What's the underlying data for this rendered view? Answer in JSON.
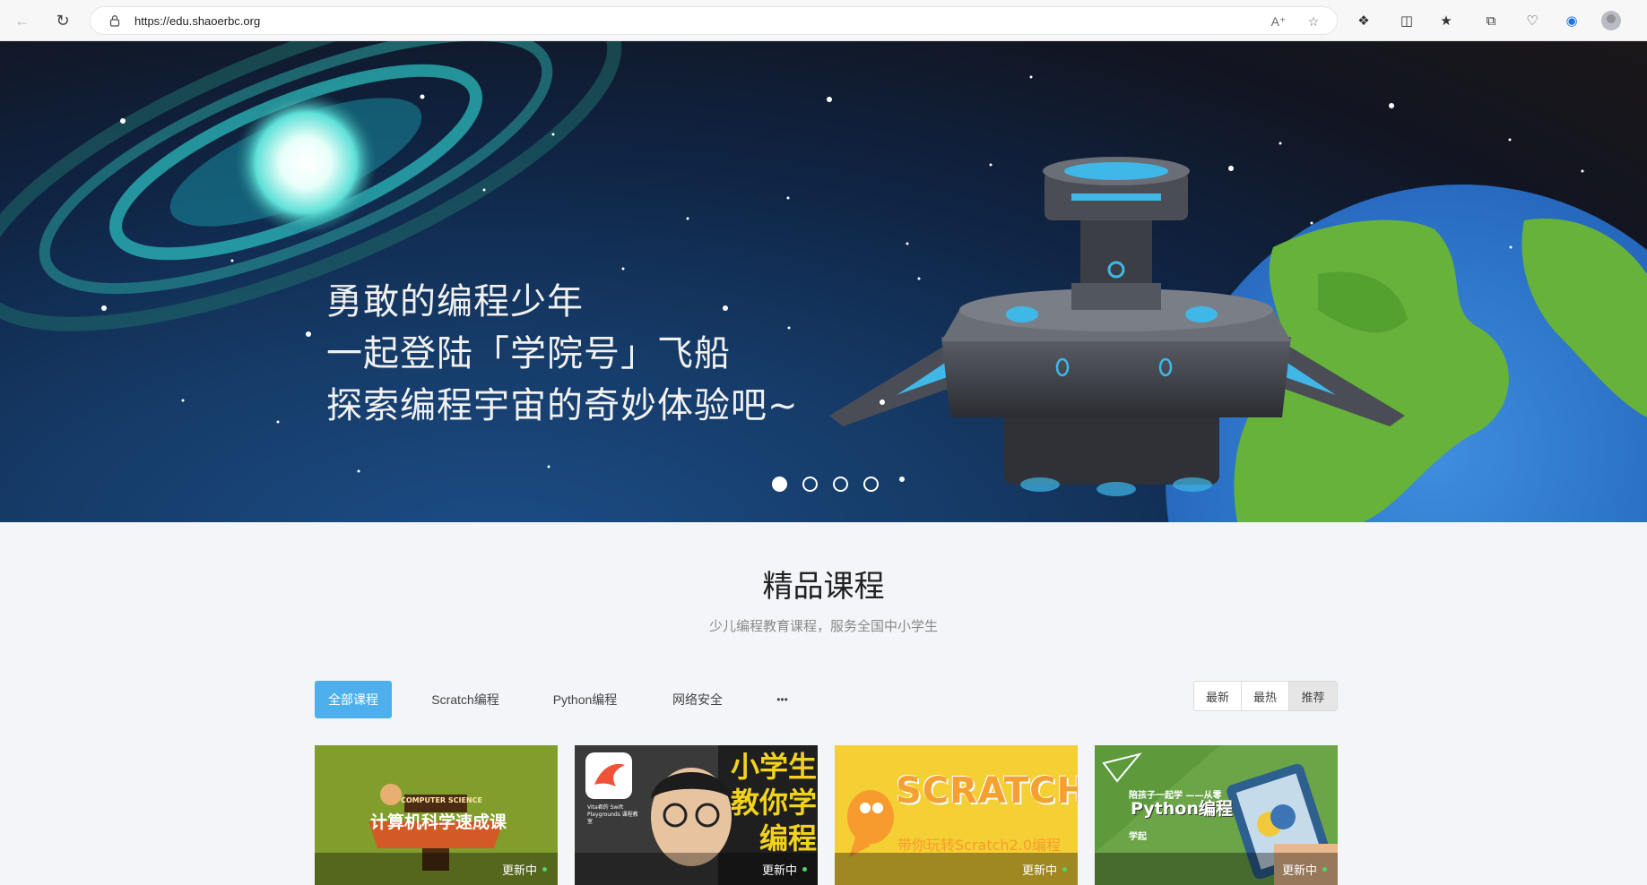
{
  "browser": {
    "url": "https://edu.shaoerbc.org"
  },
  "banner": {
    "lines": [
      "勇敢的编程少年",
      "一起登陆「学院号」飞船",
      "探索编程宇宙的奇妙体验吧~"
    ],
    "slide_count": 4,
    "active_slide": 1
  },
  "section": {
    "title": "精品课程",
    "subtitle": "少儿编程教育课程，服务全国中小学生"
  },
  "categories": [
    "全部课程",
    "Scratch编程",
    "Python编程",
    "网络安全",
    "•••"
  ],
  "sort_options": [
    "最新",
    "最热",
    "推荐"
  ],
  "courses": [
    {
      "image_text": "计算机科学速成课",
      "badge_text": "COMPUTER SCIENCE",
      "status": "更新中"
    },
    {
      "image_text": "小学生教你学编程",
      "badge_text": "Vita君的 Swift Playgrounds 课程教室",
      "status": "更新中"
    },
    {
      "image_text": "带你玩转Scratch2.0编程",
      "badge_text": "SCRATCH",
      "status": "更新中"
    },
    {
      "image_text": "Python编程",
      "badge_text": "陪孩子一起学 ——从零学起",
      "status": "更新中"
    }
  ],
  "colors": {
    "accent": "#4db0ec",
    "status_dot": "#52d36a"
  }
}
